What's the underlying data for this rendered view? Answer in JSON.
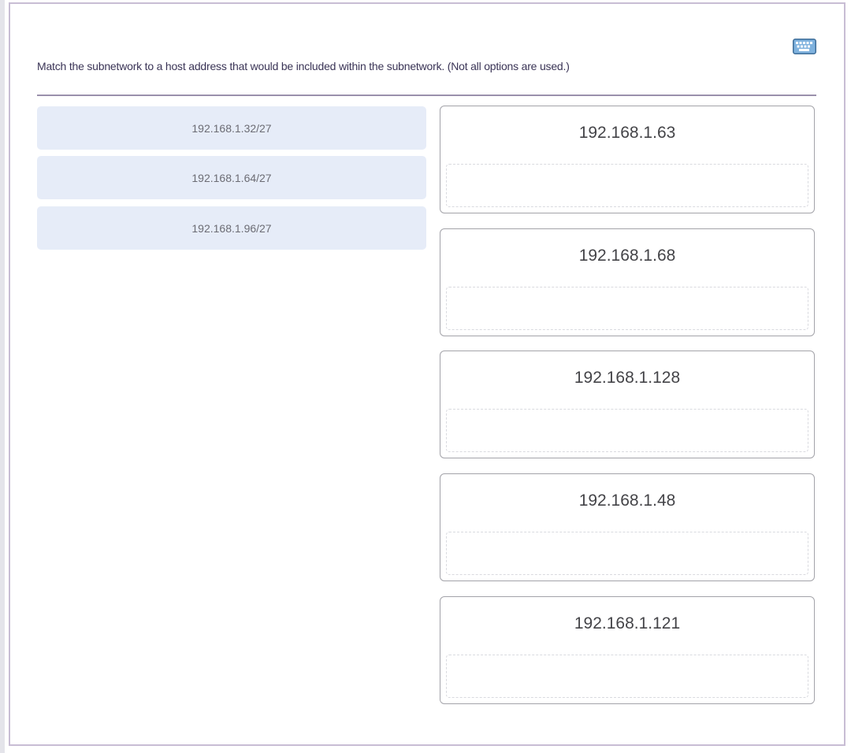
{
  "question": {
    "instructions": "Match the subnetwork to a host address that would be included within the subnetwork. (Not all options are used.)"
  },
  "toolbar": {
    "keyboard_icon": "keyboard-icon"
  },
  "options": [
    {
      "label": "192.168.1.32/27"
    },
    {
      "label": "192.168.1.64/27"
    },
    {
      "label": "192.168.1.96/27"
    }
  ],
  "targets": [
    {
      "label": "192.168.1.63",
      "answer": ""
    },
    {
      "label": "192.168.1.68",
      "answer": ""
    },
    {
      "label": "192.168.1.128",
      "answer": ""
    },
    {
      "label": "192.168.1.48",
      "answer": ""
    },
    {
      "label": "192.168.1.121",
      "answer": ""
    }
  ],
  "colors": {
    "option_bg": "#e6ecf8",
    "frame_border": "#c8bdd4",
    "divider": "#9a90ac",
    "instruction_text": "#3a3456"
  }
}
